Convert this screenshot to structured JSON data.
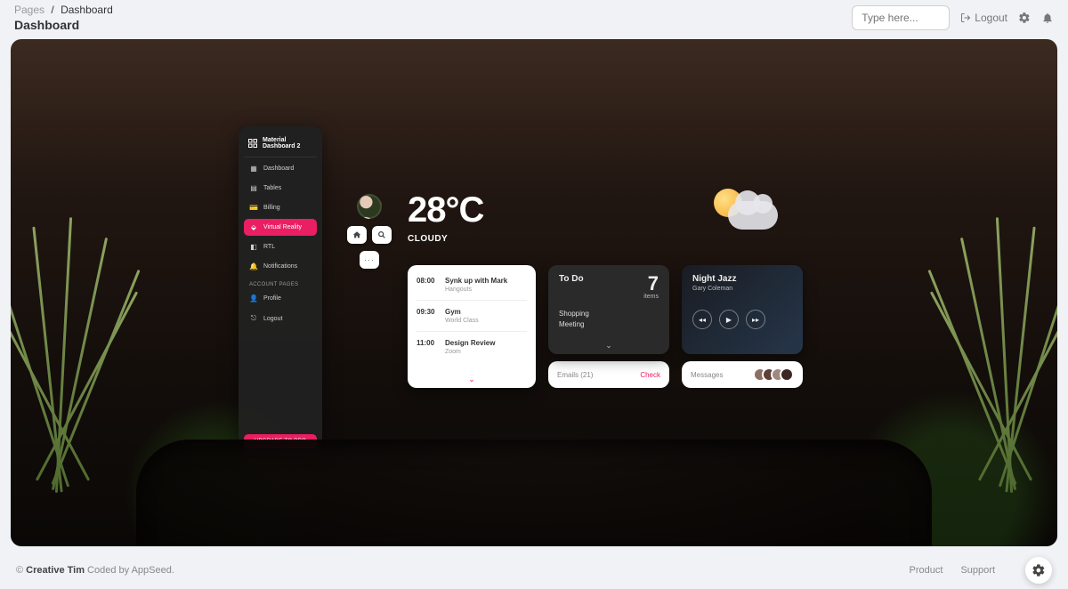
{
  "breadcrumb": {
    "root": "Pages",
    "current": "Dashboard"
  },
  "page_title": "Dashboard",
  "search": {
    "placeholder": "Type here..."
  },
  "top_actions": {
    "logout": "Logout"
  },
  "sidebar": {
    "brand": "Material Dashboard 2",
    "items": [
      {
        "icon": "dashboard-icon",
        "label": "Dashboard"
      },
      {
        "icon": "tables-icon",
        "label": "Tables"
      },
      {
        "icon": "billing-icon",
        "label": "Billing"
      },
      {
        "icon": "vr-icon",
        "label": "Virtual Reality",
        "active": true
      },
      {
        "icon": "rtl-icon",
        "label": "RTL"
      },
      {
        "icon": "notifications-icon",
        "label": "Notifications"
      }
    ],
    "section_label": "ACCOUNT PAGES",
    "account_items": [
      {
        "icon": "profile-icon",
        "label": "Profile"
      },
      {
        "icon": "logout-icon",
        "label": "Logout"
      }
    ],
    "upgrade_label": "UPGRADE TO PRO"
  },
  "weather": {
    "temperature": "28°C",
    "condition": "CLOUDY"
  },
  "schedule": {
    "rows": [
      {
        "time": "08:00",
        "title": "Synk up with Mark",
        "sub": "Hangouts"
      },
      {
        "time": "09:30",
        "title": "Gym",
        "sub": "World Class"
      },
      {
        "time": "11:00",
        "title": "Design Review",
        "sub": "Zoom"
      }
    ]
  },
  "todo": {
    "title": "To Do",
    "count": "7",
    "count_label": "items",
    "items": [
      "Shopping",
      "Meeting"
    ]
  },
  "emails": {
    "label": "Emails (21)",
    "action": "Check"
  },
  "music": {
    "title": "Night Jazz",
    "artist": "Gary Coleman"
  },
  "messages": {
    "label": "Messages"
  },
  "footer": {
    "copyright_prefix": "© ",
    "brand": "Creative Tim",
    "suffix": " Coded by AppSeed.",
    "links": [
      "Product",
      "Support"
    ]
  }
}
